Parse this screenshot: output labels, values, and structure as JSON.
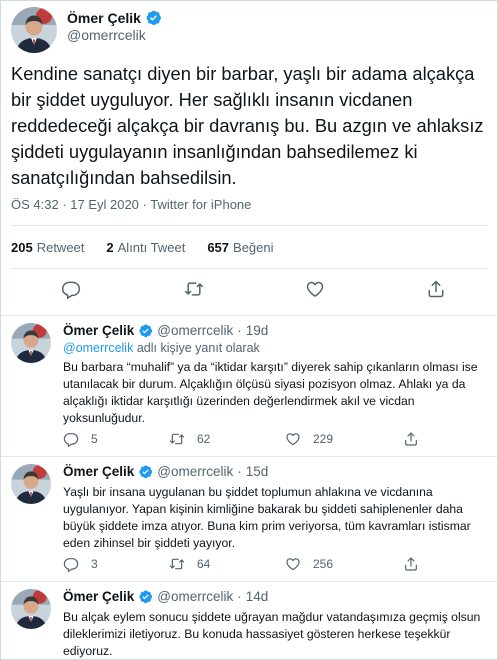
{
  "main_tweet": {
    "author_name": "Ömer Çelik",
    "author_handle": "@omerrcelik",
    "text": "Kendine sanatçı diyen bir barbar, yaşlı bir adama alçakça bir şiddet uyguluyor. Her sağlıklı insanın vicdanen reddedeceği alçakça bir davranış bu. Bu azgın ve ahlaksız şiddeti uygulayanın insanlığından bahsedilemez ki sanatçılığından bahsedilsin.",
    "meta": "ÖS 4:32 · 17 Eyl 2020 · Twitter for iPhone",
    "stats": {
      "retweets_count": "205",
      "retweets_label": "Retweet",
      "quotes_count": "2",
      "quotes_label": "Alıntı Tweet",
      "likes_count": "657",
      "likes_label": "Beğeni"
    },
    "actions": [
      "reply-icon",
      "retweet-icon",
      "like-icon",
      "share-icon"
    ]
  },
  "replies": [
    {
      "author_name": "Ömer Çelik",
      "author_handle": "@omerrcelik",
      "dot": "·",
      "time": "19d",
      "replying_to_mention": "@omerrcelik",
      "replying_to_suffix": " adlı kişiye yanıt olarak",
      "text": "Bu barbara “muhalif” ya da “iktidar karşıtı” diyerek sahip çıkanların olması ise utanılacak bir durum. Alçaklığın ölçüsü siyasi pozisyon olmaz. Ahlakı ya da alçaklığı iktidar karşıtlığı üzerinden değerlendirmek akıl ve vicdan yoksunluğudur.",
      "reply_count": "5",
      "retweet_count": "62",
      "like_count": "229"
    },
    {
      "author_name": "Ömer Çelik",
      "author_handle": "@omerrcelik",
      "dot": "·",
      "time": "15d",
      "text": "Yaşlı bir insana uygulanan bu şiddet toplumun ahlakına ve vicdanına uygulanıyor. Yapan kişinin kimliğine bakarak bu şiddeti sahiplenenler daha büyük şiddete imza atıyor. Buna kim prim veriyorsa, tüm kavramları istismar eden zihinsel bir şiddeti yayıyor.",
      "reply_count": "3",
      "retweet_count": "64",
      "like_count": "256"
    },
    {
      "author_name": "Ömer Çelik",
      "author_handle": "@omerrcelik",
      "dot": "·",
      "time": "14d",
      "text": "Bu alçak eylem sonucu şiddete uğrayan mağdur vatandaşımıza geçmiş olsun dileklerimizi iletiyoruz. Bu konuda hassasiyet gösteren herkese teşekkür ediyoruz."
    }
  ],
  "colors": {
    "verified_blue": "#1d9bf0",
    "text_primary": "#0f1419",
    "text_secondary": "#536471",
    "divider": "#e1e8ed"
  }
}
